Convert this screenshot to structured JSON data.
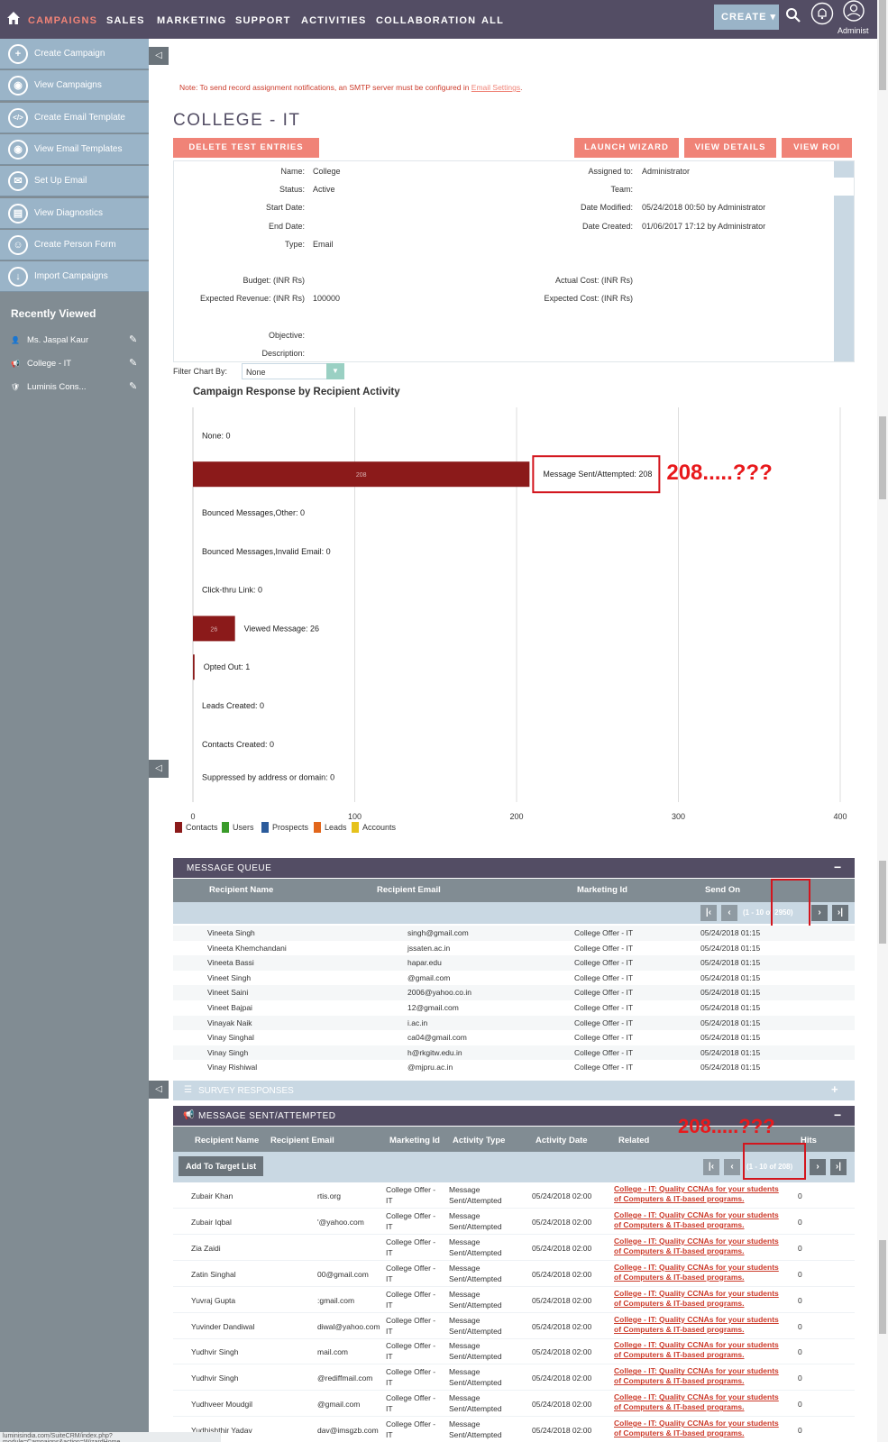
{
  "nav": {
    "items": [
      "CAMPAIGNS",
      "SALES",
      "MARKETING",
      "SUPPORT",
      "ACTIVITIES",
      "COLLABORATION",
      "ALL"
    ],
    "create": "CREATE",
    "user": "Administ"
  },
  "sidebar": {
    "actions": [
      "Create Campaign",
      "View Campaigns",
      "Create Email Template",
      "View Email Templates",
      "Set Up Email",
      "View Diagnostics",
      "Create Person Form",
      "Import Campaigns"
    ],
    "recent_title": "Recently Viewed",
    "recent": [
      "Ms. Jaspal Kaur",
      "College - IT",
      "Luminis Cons..."
    ]
  },
  "note": {
    "text": "Note: To send record assignment notifications, an SMTP server must be configured in ",
    "link": "Email Settings",
    "end": "."
  },
  "title": "COLLEGE - IT",
  "buttons": {
    "delete_test": "DELETE TEST ENTRIES",
    "launch_wizard": "LAUNCH WIZARD",
    "view_details": "VIEW DETAILS",
    "view_roi": "VIEW ROI"
  },
  "detail": {
    "left": [
      {
        "label": "Name:",
        "value": "College"
      },
      {
        "label": "Status:",
        "value": "Active"
      },
      {
        "label": "Start Date:",
        "value": ""
      },
      {
        "label": "End Date:",
        "value": ""
      },
      {
        "label": "Type:",
        "value": "Email"
      },
      {
        "label": "",
        "value": ""
      },
      {
        "label": "Budget: (INR Rs)",
        "value": ""
      },
      {
        "label": "Expected Revenue: (INR Rs)",
        "value": "100000"
      },
      {
        "label": "",
        "value": ""
      },
      {
        "label": "Objective:",
        "value": ""
      },
      {
        "label": "Description:",
        "value": ""
      }
    ],
    "right": [
      {
        "label": "Assigned to:",
        "value": "Administrator"
      },
      {
        "label": "Team:",
        "value": ""
      },
      {
        "label": "Date Modified:",
        "value": "05/24/2018 00:50 by Administrator"
      },
      {
        "label": "Date Created:",
        "value": "01/06/2017 17:12 by Administrator"
      },
      {
        "label": "",
        "value": ""
      },
      {
        "label": "",
        "value": ""
      },
      {
        "label": "Actual Cost: (INR Rs)",
        "value": ""
      },
      {
        "label": "Expected Cost: (INR Rs)",
        "value": ""
      }
    ]
  },
  "filter": {
    "label": "Filter Chart By:",
    "value": "None"
  },
  "chart_data": {
    "type": "bar",
    "orientation": "horizontal",
    "title": "Campaign Response by Recipient Activity",
    "xlim": [
      0,
      400
    ],
    "xticks": [
      "0",
      "100",
      "200",
      "300",
      "400"
    ],
    "categories": [
      "None",
      "Message Sent/Attempted",
      "Bounced Messages,Other",
      "Bounced Messages,Invalid Email",
      "Click-thru Link",
      "Viewed Message",
      "Opted Out",
      "Leads Created",
      "Contacts Created",
      "Suppressed by address or domain"
    ],
    "labels": [
      "None: 0",
      "Message Sent/Attempted: 208",
      "Bounced Messages,Other: 0",
      "Bounced Messages,Invalid Email: 0",
      "Click-thru Link: 0",
      "Viewed Message: 26",
      "Opted Out: 1",
      "Leads Created: 0",
      "Contacts Created: 0",
      "Suppressed by address or domain: 0"
    ],
    "values": [
      0,
      208,
      0,
      0,
      0,
      26,
      1,
      0,
      0,
      0
    ],
    "bar_value_labels": [
      "",
      "208",
      "",
      "",
      "",
      "26",
      "",
      "",
      "",
      ""
    ],
    "legend": [
      {
        "name": "Contacts",
        "color": "#8b1a1a"
      },
      {
        "name": "Users",
        "color": "#3a9b2a"
      },
      {
        "name": "Prospects",
        "color": "#2b5b9b"
      },
      {
        "name": "Leads",
        "color": "#e2661b"
      },
      {
        "name": "Accounts",
        "color": "#e6c21c"
      }
    ],
    "annotation": "208.....???"
  },
  "message_queue": {
    "title": "MESSAGE QUEUE",
    "collapse": "−",
    "columns": [
      "Recipient Name",
      "Recipient Email",
      "Marketing Id",
      "Send On"
    ],
    "pager": "(1 - 10 of 2950)",
    "rows": [
      [
        "Vineeta Singh",
        "singh@gmail.com",
        "College Offer - IT",
        "05/24/2018 01:15"
      ],
      [
        "Vineeta Khemchandani",
        "jssaten.ac.in",
        "College Offer - IT",
        "05/24/2018 01:15"
      ],
      [
        "Vineeta Bassi",
        "hapar.edu",
        "College Offer - IT",
        "05/24/2018 01:15"
      ],
      [
        "Vineet Singh",
        "@gmail.com",
        "College Offer - IT",
        "05/24/2018 01:15"
      ],
      [
        "Vineet Saini",
        "2006@yahoo.co.in",
        "College Offer - IT",
        "05/24/2018 01:15"
      ],
      [
        "Vineet Bajpai",
        "12@gmail.com",
        "College Offer - IT",
        "05/24/2018 01:15"
      ],
      [
        "Vinayak Naik",
        "i.ac.in",
        "College Offer - IT",
        "05/24/2018 01:15"
      ],
      [
        "Vinay Singhal",
        "ca04@gmail.com",
        "College Offer - IT",
        "05/24/2018 01:15"
      ],
      [
        "Vinay Singh",
        "h@rkgitw.edu.in",
        "College Offer - IT",
        "05/24/2018 01:15"
      ],
      [
        "Vinay Rishiwal",
        "@mjpru.ac.in",
        "College Offer - IT",
        "05/24/2018 01:15"
      ]
    ]
  },
  "survey": {
    "title": "SURVEY RESPONSES",
    "expand": "+"
  },
  "message_sent": {
    "title": "MESSAGE SENT/ATTEMPTED",
    "collapse": "−",
    "columns": [
      "Recipient Name",
      "Recipient Email",
      "Marketing Id",
      "Activity Type",
      "Activity Date",
      "Related",
      "Hits"
    ],
    "add_button": "Add To Target List",
    "pager": "(1 - 10 of 208)",
    "annotation": "208.....???",
    "marketing": [
      "College Offer -",
      "IT"
    ],
    "activity": [
      "Message",
      "Sent/Attempted"
    ],
    "date": "05/24/2018 02:00",
    "related": [
      "College - IT: Quality CCNAs for your students",
      "of Computers & IT-based programs."
    ],
    "rows": [
      [
        "Zubair Khan",
        "rtis.org",
        "0"
      ],
      [
        "Zubair Iqbal",
        "'@yahoo.com",
        "0"
      ],
      [
        "Zia Zaidi",
        "",
        "0"
      ],
      [
        "Zatin Singhal",
        "00@gmail.com",
        "0"
      ],
      [
        "Yuvraj Gupta",
        ":gmail.com",
        "0"
      ],
      [
        "Yuvinder Dandiwal",
        "diwal@yahoo.com",
        "0"
      ],
      [
        "Yudhvir Singh",
        "mail.com",
        "0"
      ],
      [
        "Yudhvir Singh",
        "@rediffmail.com",
        "0"
      ],
      [
        "Yudhveer Moudgil",
        "@gmail.com",
        "0"
      ],
      [
        "Yudhishthir Yadav",
        "dav@imsgzb.com",
        "0"
      ]
    ]
  },
  "status": "luminisindia.com/SuiteCRM/index.php?module=Campaigns&action=WizardHome"
}
